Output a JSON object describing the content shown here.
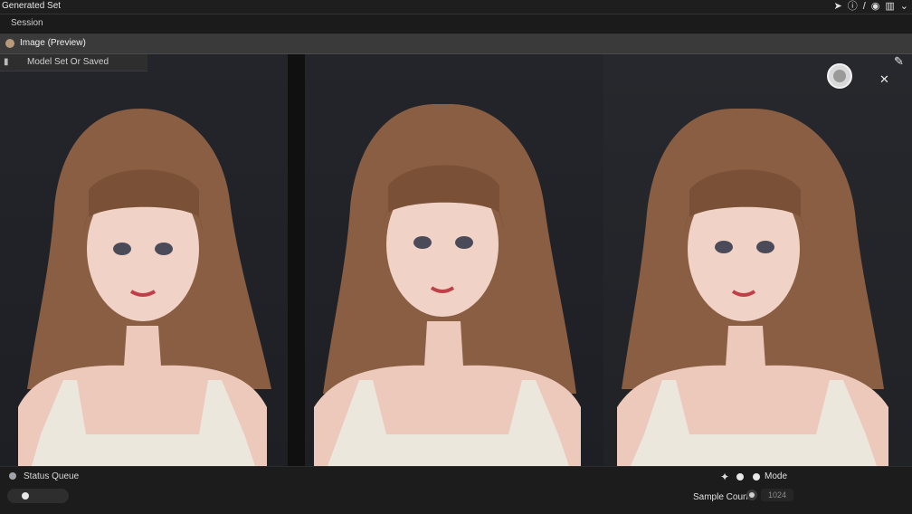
{
  "window": {
    "title": "Generated Set",
    "icons": [
      "arrow-icon",
      "info-icon",
      "slash-icon",
      "eye-icon",
      "panel-icon",
      "chevron-down-icon"
    ]
  },
  "menubar": {
    "label": "Session"
  },
  "tab": {
    "label": "Image (Preview)"
  },
  "dropdown": {
    "label": "Model Set Or Saved"
  },
  "gallery": {
    "images": [
      {
        "name": "portrait-1"
      },
      {
        "name": "portrait-2"
      },
      {
        "name": "portrait-3"
      }
    ]
  },
  "overlay": {
    "close_glyph": "✕",
    "edit_glyph": "✎"
  },
  "bottombar": {
    "status_label": "Status Queue",
    "mode_label": "Mode",
    "setting_label": "Sample Count",
    "setting_value": "1024"
  },
  "colors": {
    "background": "#141414",
    "panel": "#23252b",
    "hair": "#8a5e43",
    "skin": "#f0d3c6",
    "top": "#ece7dd"
  }
}
